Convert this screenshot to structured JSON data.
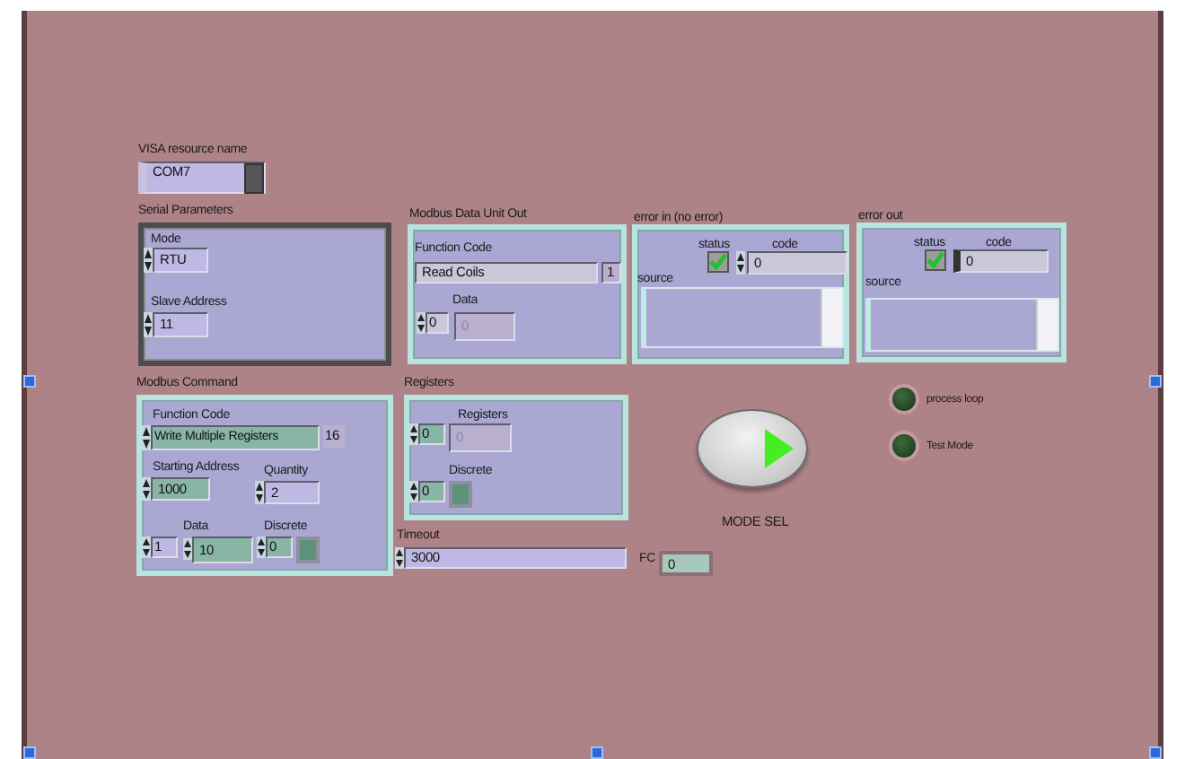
{
  "visa_resource": {
    "label": "VISA resource name",
    "value": "COM7"
  },
  "serial_parameters": {
    "label": "Serial Parameters",
    "mode": {
      "label": "Mode",
      "value": "RTU"
    },
    "slave_address": {
      "label": "Slave Address",
      "value": "11"
    }
  },
  "modbus_data_unit_out": {
    "label": "Modbus Data Unit Out",
    "function_code": {
      "label": "Function Code",
      "value": "Read Coils",
      "number": "1"
    },
    "data": {
      "label": "Data",
      "index": "0",
      "value": "0",
      "disabled": true
    }
  },
  "error_in": {
    "label": "error in (no error)",
    "status_label": "status",
    "checked": true,
    "code_label": "code",
    "code": "0",
    "source_label": "source"
  },
  "error_out": {
    "label": "error out",
    "status_label": "status",
    "checked": true,
    "code_label": "code",
    "code": "0",
    "source_label": "source"
  },
  "modbus_command": {
    "label": "Modbus Command",
    "function_code": {
      "label": "Function Code",
      "value": "Write Multiple Registers",
      "number": "16"
    },
    "starting_address": {
      "label": "Starting Address",
      "value": "1000"
    },
    "quantity": {
      "label": "Quantity",
      "value": "2"
    },
    "data": {
      "label": "Data",
      "index": "1",
      "value": "10"
    },
    "discrete": {
      "label": "Discrete",
      "index": "0",
      "on": false
    }
  },
  "registers": {
    "label": "Registers",
    "registers": {
      "label": "Registers",
      "index": "0",
      "value": "0",
      "disabled": true
    },
    "discrete": {
      "label": "Discrete",
      "index": "0",
      "on": false
    }
  },
  "timeout": {
    "label": "Timeout",
    "value": "3000"
  },
  "fc": {
    "label": "FC",
    "value": "0"
  },
  "mode_sel": {
    "label": "MODE SEL"
  },
  "leds": [
    {
      "label": "process loop",
      "on": false
    },
    {
      "label": "Test Mode",
      "on": false
    }
  ]
}
